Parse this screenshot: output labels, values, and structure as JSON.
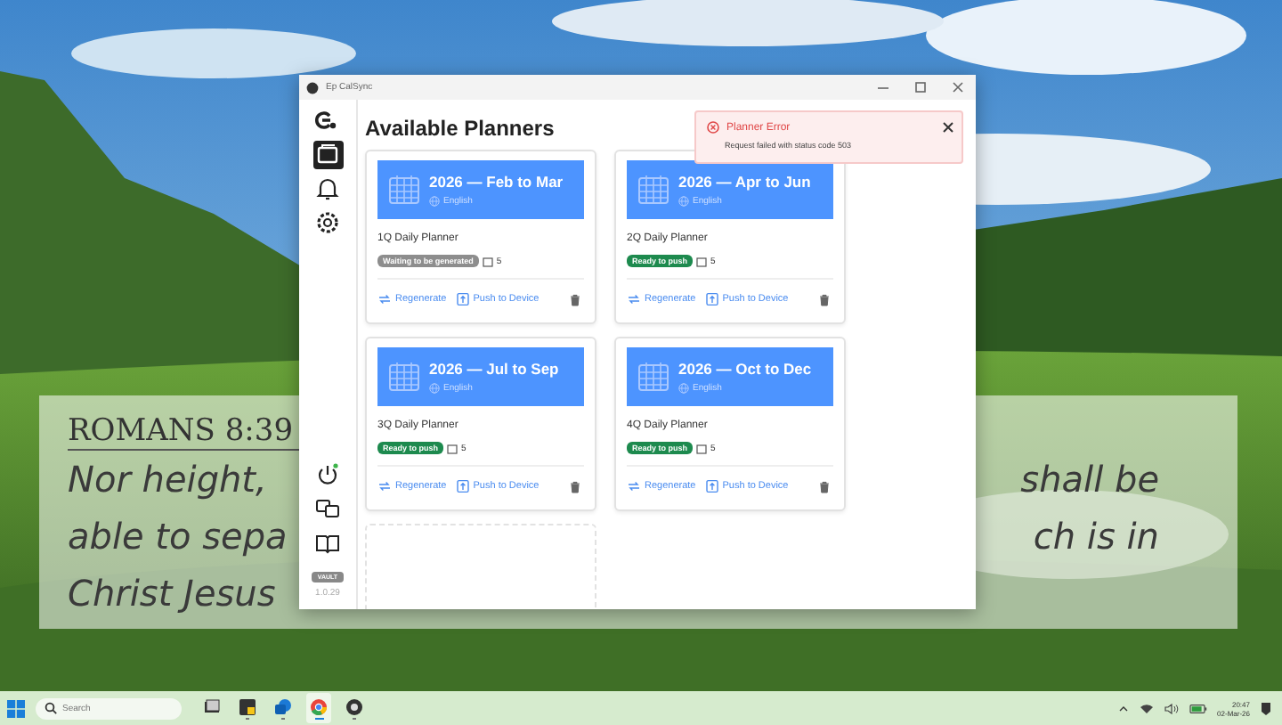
{
  "widget": {
    "reference": "ROMANS 8:39",
    "lines": [
      {
        "left": "Nor height,",
        "right": "shall be"
      },
      {
        "left": "able to sepa",
        "right": "ch is in"
      },
      {
        "left": "Christ Jesus"
      }
    ]
  },
  "window": {
    "title": "Ep CalSync",
    "sidebar": {
      "items": [
        {
          "selected": false
        },
        {
          "selected": true
        },
        {
          "selected": false
        },
        {
          "selected": false
        }
      ],
      "badge": "VAULT",
      "version": "1.0.29"
    },
    "main": {
      "title": "Available Planners",
      "planners": [
        {
          "kind": "planner",
          "title": "2026 — Feb to Mar",
          "language": "English",
          "name": "1Q Daily Planner",
          "status": {
            "kind": "waiting",
            "label": "Waiting to be generated"
          },
          "count": "5",
          "actions": [
            "Regenerate",
            "Push to Device"
          ]
        },
        {
          "kind": "planner",
          "title": "2026 — Apr to Jun",
          "language": "English",
          "name": "2Q Daily Planner",
          "status": {
            "kind": "ready",
            "label": "Ready to push"
          },
          "count": "5",
          "actions": [
            "Regenerate",
            "Push to Device"
          ]
        },
        {
          "kind": "planner",
          "title": "2026 — Jul to Sep",
          "language": "English",
          "name": "3Q Daily Planner",
          "status": {
            "kind": "ready",
            "label": "Ready to push"
          },
          "count": "5",
          "actions": [
            "Regenerate",
            "Push to Device"
          ]
        },
        {
          "kind": "planner",
          "title": "2026 — Oct to Dec",
          "language": "English",
          "name": "4Q Daily Planner",
          "status": {
            "kind": "ready",
            "label": "Ready to push"
          },
          "count": "5",
          "actions": [
            "Regenerate",
            "Push to Device"
          ]
        },
        {
          "kind": "empty"
        }
      ]
    },
    "toast": {
      "title": "Planner Error",
      "message": "Request failed with status code 503"
    }
  },
  "taskbar": {
    "search": {
      "placeholder": "Search"
    },
    "apps": [
      {
        "selected": false,
        "running": false
      },
      {
        "selected": false,
        "running": true
      },
      {
        "selected": false,
        "running": true
      },
      {
        "selected": true,
        "running": true
      },
      {
        "selected": false,
        "running": true
      }
    ],
    "time": "20:47",
    "date": "02-Mar-26"
  }
}
